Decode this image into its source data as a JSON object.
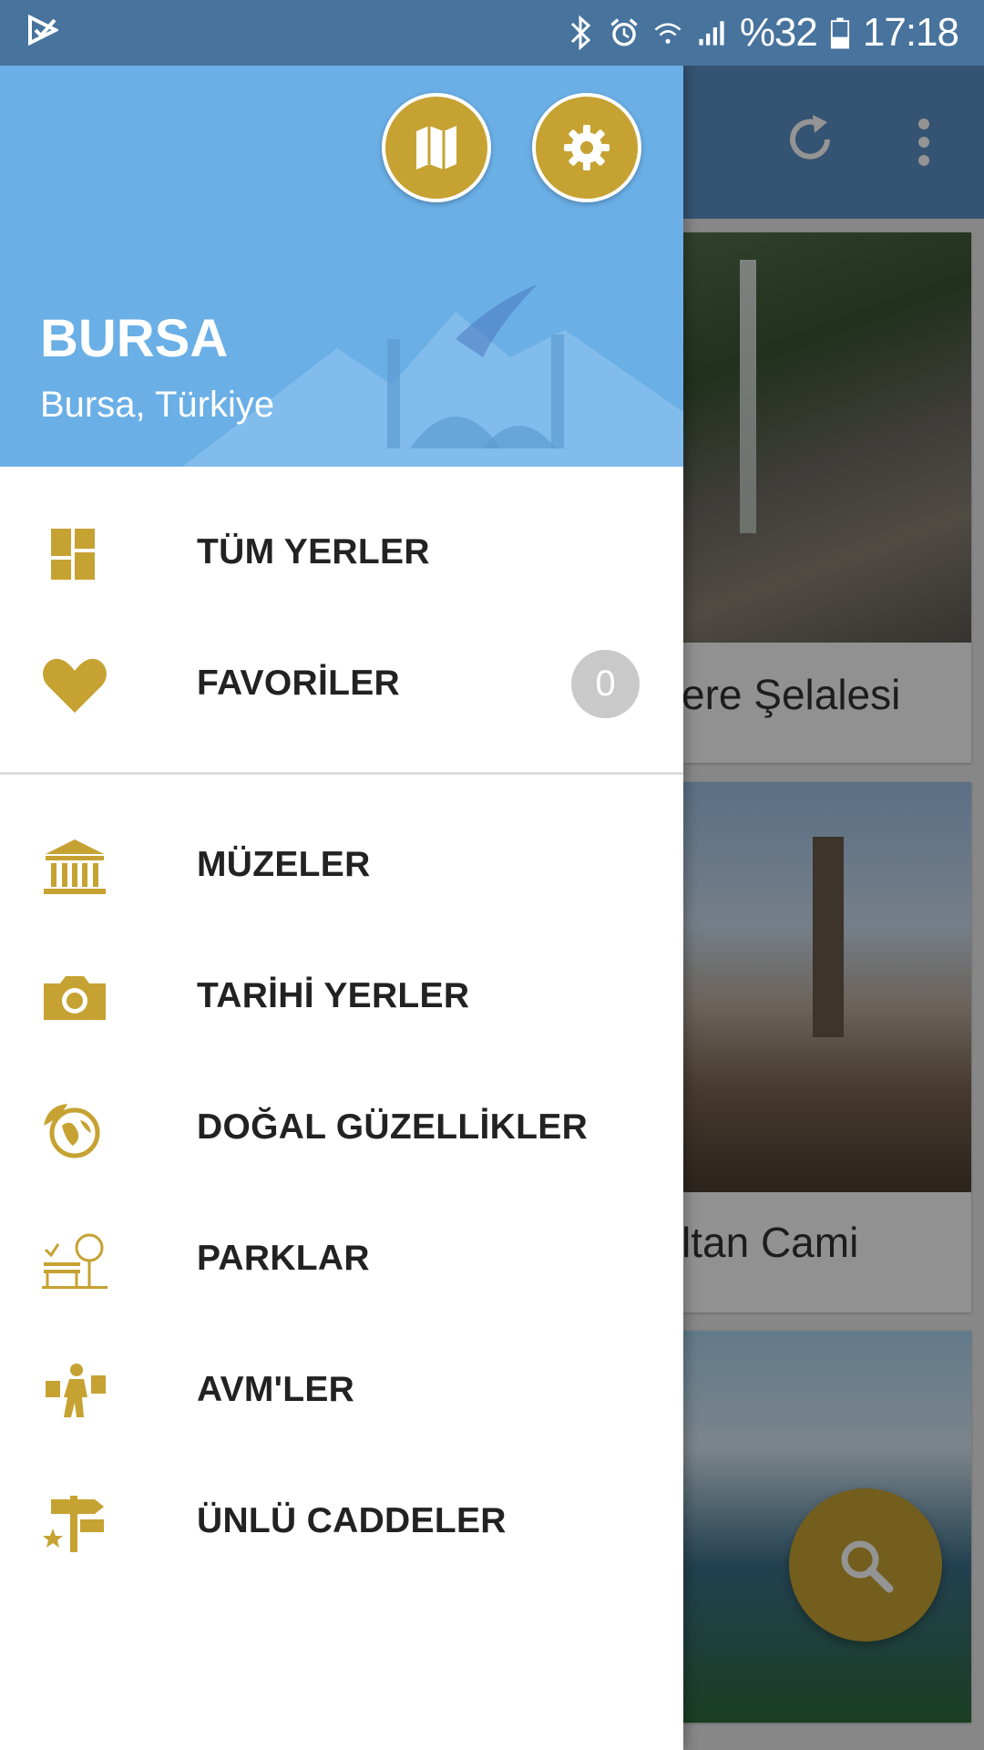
{
  "status_bar": {
    "battery_percent": "%32",
    "time": "17:18"
  },
  "background_app": {
    "cards": [
      {
        "title": "ere Şelalesi"
      },
      {
        "title": "ltan Cami"
      },
      {
        "title": ""
      }
    ]
  },
  "drawer": {
    "header": {
      "city": "BURSA",
      "region": "Bursa, Türkiye"
    },
    "top_items": [
      {
        "label": "TÜM YERLER",
        "icon": "dashboard-icon"
      },
      {
        "label": "FAVORİLER",
        "icon": "heart-icon",
        "badge": "0"
      }
    ],
    "category_items": [
      {
        "label": "MÜZELER",
        "icon": "museum-icon"
      },
      {
        "label": "TARİHİ YERLER",
        "icon": "camera-icon"
      },
      {
        "label": "DOĞAL GÜZELLİKLER",
        "icon": "globe-leaf-icon"
      },
      {
        "label": "PARKLAR",
        "icon": "park-bench-icon"
      },
      {
        "label": "AVM'LER",
        "icon": "shopping-person-icon"
      },
      {
        "label": "ÜNLÜ CADDELER",
        "icon": "signpost-icon"
      }
    ]
  },
  "colors": {
    "accent_gold": "#c6a232",
    "header_blue": "#6aafe6",
    "status_bar": "#47739d"
  }
}
